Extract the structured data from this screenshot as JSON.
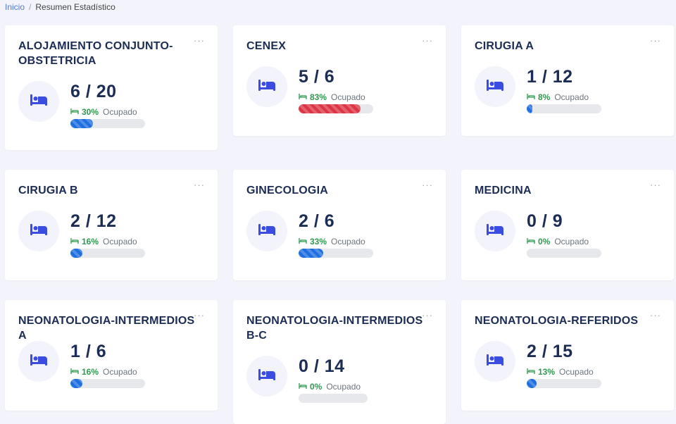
{
  "breadcrumb": {
    "home": "Inicio",
    "separator": "/",
    "current": "Resumen Estadístico"
  },
  "common": {
    "menu_label": "···",
    "occupied_label": "Ocupado"
  },
  "icons": {
    "bed": "bed-icon",
    "small_bed": "small-bed-icon"
  },
  "colors": {
    "accent": "#1f6fe0",
    "danger": "#dc3545",
    "success": "#2e9a4f",
    "title": "#1b2c55",
    "icon": "#3b4ce0"
  },
  "cards": [
    {
      "title": "ALOJAMIENTO CONJUNTO-OBSTETRICIA",
      "value": "6 / 20",
      "pct": "30%",
      "occupancy": 0.3,
      "status": "normal"
    },
    {
      "title": "CENEX",
      "value": "5 / 6",
      "pct": "83%",
      "occupancy": 0.83,
      "status": "danger"
    },
    {
      "title": "CIRUGIA A",
      "value": "1 / 12",
      "pct": "8%",
      "occupancy": 0.08,
      "status": "normal"
    },
    {
      "title": "CIRUGIA B",
      "value": "2 / 12",
      "pct": "16%",
      "occupancy": 0.16,
      "status": "normal"
    },
    {
      "title": "GINECOLOGIA",
      "value": "2 / 6",
      "pct": "33%",
      "occupancy": 0.33,
      "status": "normal"
    },
    {
      "title": "MEDICINA",
      "value": "0 / 9",
      "pct": "0%",
      "occupancy": 0.0,
      "status": "normal"
    },
    {
      "title": "NEONATOLOGIA-INTERMEDIOS A",
      "value": "1 / 6",
      "pct": "16%",
      "occupancy": 0.16,
      "status": "normal"
    },
    {
      "title": "NEONATOLOGIA-INTERMEDIOS B-C",
      "value": "0 / 14",
      "pct": "0%",
      "occupancy": 0.0,
      "status": "normal"
    },
    {
      "title": "NEONATOLOGIA-REFERIDOS",
      "value": "2 / 15",
      "pct": "13%",
      "occupancy": 0.13,
      "status": "normal"
    }
  ]
}
